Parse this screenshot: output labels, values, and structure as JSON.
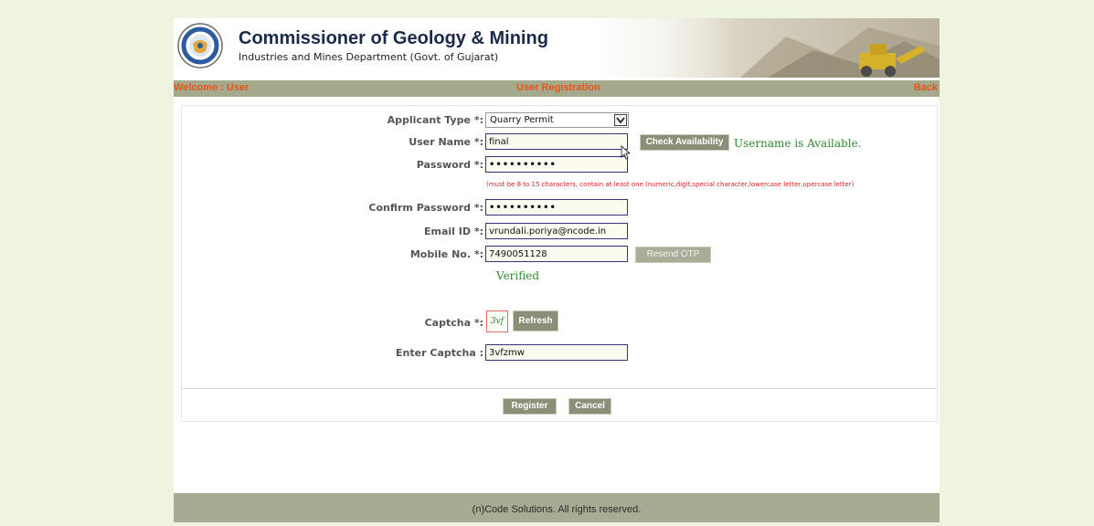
{
  "header": {
    "title": "Commissioner of Geology & Mining",
    "subtitle": "Industries and Mines Department (Govt. of Gujarat)",
    "logo_icon": "gujarat-seal-icon"
  },
  "nav": {
    "welcome": "Welcome : User",
    "page_title": "User Registration",
    "back": "Back"
  },
  "form": {
    "applicant_type": {
      "label": "Applicant Type *:",
      "value": "Quarry Permit"
    },
    "username": {
      "label": "User Name *:",
      "value": "final",
      "check_button": "Check Availability",
      "status": "Username is Available."
    },
    "password": {
      "label": "Password *:",
      "value": "••••••••••",
      "hint": "(must be 8 to 15 characters, contain at least one (numeric,digit,special character,lowercase letter,upercase letter)"
    },
    "confirm_password": {
      "label": "Confirm Password *:",
      "value": "••••••••••"
    },
    "email": {
      "label": "Email ID *:",
      "value": "vrundali.poriya@ncode.in"
    },
    "mobile": {
      "label": "Mobile No. *:",
      "value": "7490051128",
      "resend_button": "Resend OTP",
      "status": "Verified"
    },
    "captcha": {
      "label": "Captcha *:",
      "image_text": "3vf",
      "refresh_button": "Refresh"
    },
    "enter_captcha": {
      "label": "Enter Captcha :",
      "value": "3vfzmw"
    },
    "register_button": "Register",
    "cancel_button": "Cancel"
  },
  "footer": {
    "text": "(n)Code Solutions. All rights reserved."
  },
  "colors": {
    "page_bg": "#eef4df",
    "bar_bg": "#a5aa8d",
    "nav_text": "#e8541a",
    "button_bg": "#8a9078",
    "success_text": "#2d8a2d",
    "hint_text": "#e02020",
    "input_border": "#33357a"
  }
}
